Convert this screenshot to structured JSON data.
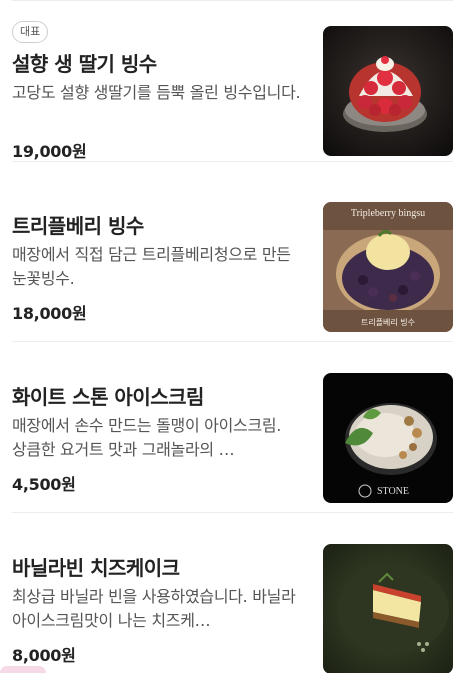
{
  "menu": {
    "items": [
      {
        "badge": "대표",
        "name": "설향 생 딸기 빙수",
        "description": "고당도 설향 생딸기를 듬뿍 올린 빙수입니다.",
        "price": "19,000원",
        "image_icon": "strawberry-bingsu-photo",
        "image_caption_top": "",
        "image_caption_bottom": ""
      },
      {
        "badge": "",
        "name": "트리플베리 빙수",
        "description": "매장에서 직접 담근 트리플베리청으로 만든 눈꽃빙수.",
        "price": "18,000원",
        "image_icon": "tripleberry-bingsu-photo",
        "image_caption_top": "Tripleberry bingsu",
        "image_caption_bottom": "트리플베리 빙수"
      },
      {
        "badge": "",
        "name": "화이트 스톤 아이스크림",
        "description": "매장에서 손수 만드는 돌맹이 아이스크림. 상큼한 요거트 맛과 그래놀라의 …",
        "price": "4,500원",
        "image_icon": "white-stone-icecream-photo",
        "image_caption_top": "",
        "image_caption_bottom": "STONE"
      },
      {
        "badge": "",
        "name": "바닐라빈 치즈케이크",
        "description": "최상급 바닐라 빈을 사용하였습니다. 바닐라 아이스크림맛이 나는 치즈케…",
        "price": "8,000원",
        "image_icon": "vanilla-cheesecake-photo",
        "image_caption_top": "",
        "image_caption_bottom": ""
      }
    ]
  },
  "colors": {
    "text_primary": "#222222",
    "text_secondary": "#555555",
    "divider": "#ececec"
  }
}
